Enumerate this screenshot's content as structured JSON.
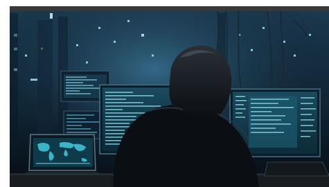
{
  "image": {
    "subject": "hooded-figure-at-computer-monitors",
    "colors": {
      "top_bar": "#3a3a3c",
      "background_deep": "#0a1722",
      "background_glow": "#2b5a78",
      "screen_glow": "#7fd0e8",
      "figure": "#0b0e12",
      "desk": "#1a1d20"
    }
  }
}
